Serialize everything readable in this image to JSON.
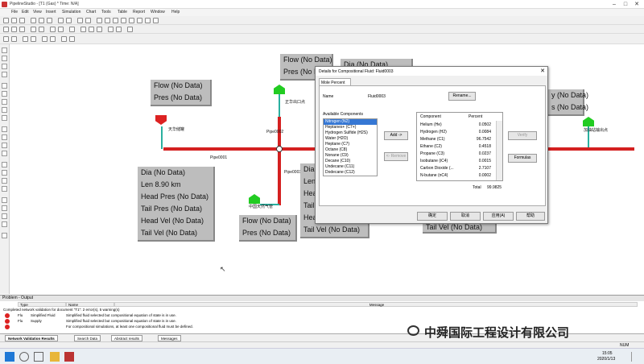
{
  "window": {
    "title": "PipelineStudio - [T1 (Gas) * Time: N/A]"
  },
  "menu": [
    "File",
    "Edit",
    "View",
    "Insert",
    "Simulation",
    "Chart",
    "Tools",
    "Table",
    "Report",
    "Window",
    "Help"
  ],
  "canvas": {
    "box_top_left": [
      "Flow (No Data)",
      "Pres (No Data)"
    ],
    "box_top_center": [
      "Flow (No Data)",
      "Pres (No Data)"
    ],
    "box_top_center2": [
      "Dia (No Data)"
    ],
    "box_pipe_left": [
      "Dia (No Data)",
      "Len 8.90 km",
      "Head Pres (No Data)",
      "Tail Pres (No Data)",
      "Head Vel (No Data)",
      "Tail Vel (No Data)"
    ],
    "box_bottom_node": [
      "Flow (No Data)",
      "Pres (No Data)"
    ],
    "box_pipe_mid": [
      "Dia",
      "Len",
      "Head",
      "Tail",
      "Head",
      "Tail Vel (No Data)"
    ],
    "box_right_bottom": [
      "Tail Vel (No Data)"
    ],
    "box_right_top": [
      "y (No Data)",
      "s (No Data)"
    ],
    "pipe_labels": {
      "p1": "Pipe0001",
      "p2": "Pipe0002",
      "p3": "Pipe0003"
    },
    "node_labels": {
      "n_left": "天华储罐",
      "n_top": "正华出口点",
      "n_bottom": "中国天然气管",
      "n_right": "加油站输出点"
    }
  },
  "dialog": {
    "title": "Details for Compositional Fluid: Fluid0003",
    "tab": "Mole Percent",
    "name_label": "Name",
    "name_value": "Fluid0003",
    "rename": "Rename...",
    "available_label": "Available Components",
    "available": [
      "Nitrogen (N2)",
      "Heptanes+ (C7+)",
      "Hydrogen Sulfide (H2S)",
      "Water (H2O)",
      "Heptane (C7)",
      "Octane (C8)",
      "Nonane (C9)",
      "Decane (C10)",
      "Undecane (C11)",
      "Dodecane (C12)"
    ],
    "add": "Add ->",
    "remove": "<- Remove",
    "table_headers": [
      "Component",
      "Percent"
    ],
    "table_rows": [
      [
        "Helium (He)",
        "0.0502"
      ],
      [
        "Hydrogen (H2)",
        "0.0084"
      ],
      [
        "Methane (C1)",
        "96.7542"
      ],
      [
        "Ethane (C2)",
        "0.4518"
      ],
      [
        "Propane (C3)",
        "0.0237"
      ],
      [
        "Isobutane (iC4)",
        "0.0015"
      ],
      [
        "Carbon Dioxide (...",
        "2.7107"
      ],
      [
        "N-butane (nC4)",
        "0.0002"
      ]
    ],
    "total_label": "Total",
    "total_value": "99.9825",
    "verify": "Verify",
    "formulas": "Formulas",
    "ok": "确定",
    "cancel": "取消",
    "apply": "应用(A)",
    "help": "帮助"
  },
  "output": {
    "title": "Problem - Output",
    "columns": [
      "Type",
      "Name",
      "Message"
    ],
    "line0": "Completed network validation for document \"T1\": 2 error(s), 5 warning(s)",
    "rows": [
      {
        "type": "Flu",
        "name": "Simplified Fluid",
        "msg": "Simplified fluid selected but compositional equation of state is in use."
      },
      {
        "type": "Flu",
        "name": "Supply",
        "msg": "Simplified fluid selected but compositional equation of state is in use."
      },
      {
        "type": "",
        "name": "",
        "msg": "For compositional simulations, at least one compositional fluid must be defined."
      }
    ]
  },
  "bottom_tabs": [
    "Network Validation Results",
    "Search Data",
    "Abstract results",
    "Messages"
  ],
  "status": {
    "right": "NUM"
  },
  "taskbar": {
    "time": "15:05",
    "date": "2020/1/13"
  },
  "watermark": "中舜国际工程设计有限公司"
}
